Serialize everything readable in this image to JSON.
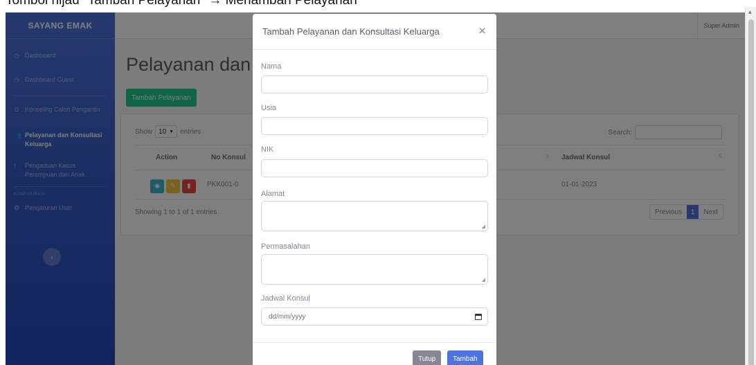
{
  "caption": "Tombol hijau \"Tambah Pelayanan\" → Menambah Pelayanan",
  "sidebar": {
    "brand": "SAYANG EMAK",
    "items": [
      {
        "label": "Dashboard"
      },
      {
        "label": "Dashboard Guest"
      },
      {
        "label": "Konseling Calon Pengantin"
      },
      {
        "label": "Pelayanan dan Konsultasi Keluarga"
      },
      {
        "label": "Pengaduan Kasus Perempuan dan Anak"
      },
      {
        "label": "Pengaturan User"
      }
    ],
    "heading": "KONFIGURASI",
    "toggle": "‹"
  },
  "topbar": {
    "user": "Super Admin"
  },
  "page": {
    "title": "Pelayanan dan Konsultasi Keluarga",
    "add_button": "Tambah Pelayanan"
  },
  "table": {
    "show_label": "Show",
    "entries_value": "10",
    "entries_label": "entries",
    "search_label": "Search:",
    "columns": [
      "Action",
      "No Konsul",
      "Jadwal Konsul"
    ],
    "rows": [
      {
        "no_konsul": "PKK001-0",
        "jadwal": "01-01-2023"
      }
    ],
    "info": "Showing 1 to 1 of 1 entries",
    "pagination": {
      "previous": "Previous",
      "current": "1",
      "next": "Next"
    }
  },
  "modal": {
    "title": "Tambah Pelayanan dan Konsultasi Keluarga",
    "close": "×",
    "fields": {
      "nama": "Nama",
      "usia": "Usia",
      "nik": "NIK",
      "alamat": "Alamat",
      "permasalahan": "Permasalahan",
      "jadwal": "Jadwal Konsul"
    },
    "date_placeholder": "dd/mm/yyyy",
    "btn_close": "Tutup",
    "btn_submit": "Tambah"
  },
  "colors": {
    "sidebar": "#4e73df",
    "success": "#1cc88a",
    "primary": "#4e73df",
    "info": "#36b9cc",
    "warning": "#f6c23e",
    "danger": "#e74a3b",
    "secondary": "#858796"
  },
  "icons": {
    "view": "eye-icon",
    "edit": "edit-icon",
    "delete": "trash-icon"
  }
}
